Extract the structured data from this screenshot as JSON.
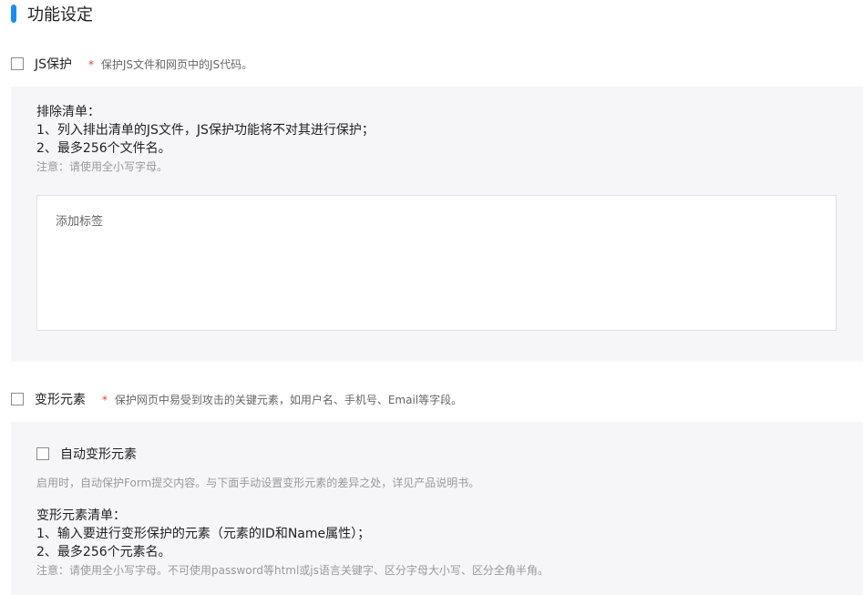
{
  "section": {
    "title": "功能设定"
  },
  "js_protect": {
    "label": "JS保护",
    "required_mark": "*",
    "note": "保护JS文件和网页中的JS代码。",
    "exclude_title": "排除清单：",
    "exclude_line1": "1、列入排出清单的JS文件，JS保护功能将不对其进行保护；",
    "exclude_line2": "2、最多256个文件名。",
    "notice": "注意：请使用全小写字母。",
    "tag_placeholder": "添加标签"
  },
  "transform": {
    "label": "变形元素",
    "required_mark": "*",
    "note": "保护网页中易受到攻击的关键元素，如用户名、手机号、Email等字段。",
    "auto_label": "自动变形元素",
    "auto_desc": "启用时，自动保护Form提交内容。与下面手动设置变形元素的差异之处，详见产品说明书。",
    "list_title": "变形元素清单：",
    "list_line1": "1、输入要进行变形保护的元素（元素的ID和Name属性）；",
    "list_line2": "2、最多256个元素名。",
    "notice": "注意：请使用全小写字母。不可使用password等html或js语言关键字、区分字母大小写、区分全角半角。"
  }
}
